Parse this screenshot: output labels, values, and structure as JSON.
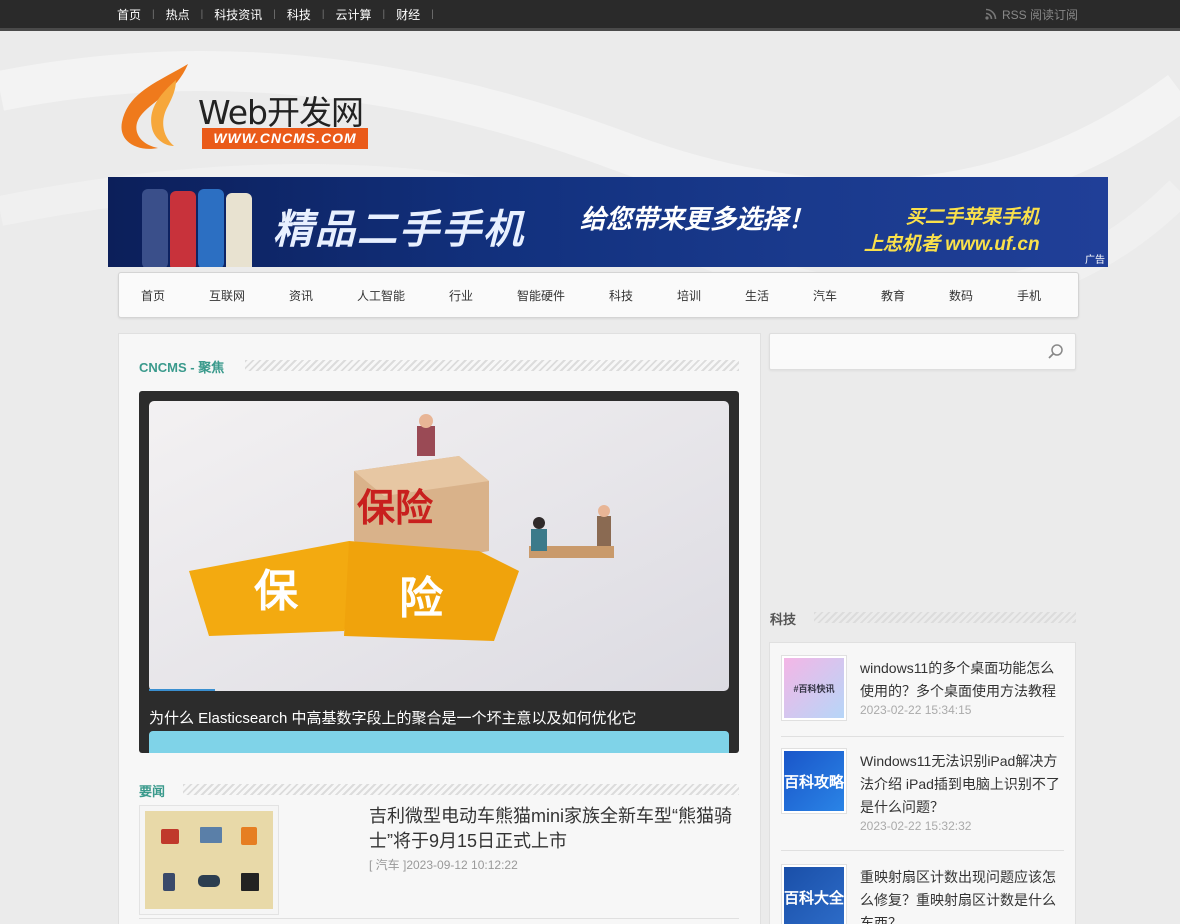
{
  "topbar": {
    "links": [
      "首页",
      "热点",
      "科技资讯",
      "科技",
      "云计算",
      "财经"
    ],
    "rss": "RSS 阅读订阅"
  },
  "logo": {
    "name": "Web开发网",
    "url": "WWW.CNCMS.COM"
  },
  "banner": {
    "slogan": "精品二手手机",
    "sub": "给您带来更多选择！",
    "cta_line1": "买二手苹果手机",
    "cta_line2": "上忠机者 www.uf.cn",
    "ad_label": "广告"
  },
  "mainnav": [
    "首页",
    "互联网",
    "资讯",
    "人工智能",
    "行业",
    "智能硬件",
    "科技",
    "培训",
    "生活",
    "汽车",
    "教育",
    "数码",
    "手机"
  ],
  "focus": {
    "title": "CNCMS - 聚焦",
    "slide_caption": "为什么 Elasticsearch 中高基数字段上的聚合是一个坏主意以及如何优化它",
    "puzzle_left": "保",
    "puzzle_right": "险",
    "box_text": "保险"
  },
  "news": {
    "title": "要闻",
    "items": [
      {
        "title": "吉利微型电动车熊猫mini家族全新车型“熊猫骑士”将于9月15日正式上市",
        "meta": "[ 汽车 ]2023-09-12 10:12:22"
      }
    ]
  },
  "search": {
    "placeholder": ""
  },
  "sidebar": {
    "title": "科技",
    "items": [
      {
        "title": "windows11的多个桌面功能怎么使用的？多个桌面使用方法教程",
        "date": "2023-02-22 15:34:15",
        "thumb": "#百科快讯"
      },
      {
        "title": "Windows11无法识别iPad解决方法介绍 iPad插到电脑上识别不了是什么问题？",
        "date": "2023-02-22 15:32:32",
        "thumb": "百科攻略"
      },
      {
        "title": "重映射扇区计数出现问题应该怎么修复？重映射扇区计数是什么东西？",
        "date": "",
        "thumb": "百科大全"
      }
    ]
  }
}
